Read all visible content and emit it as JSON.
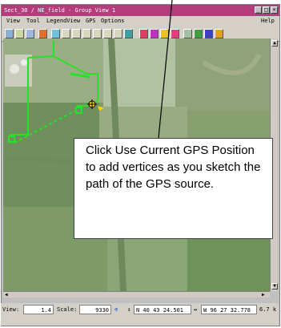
{
  "window": {
    "title": "Sect_30 / NE_field - Group View 1",
    "controls": [
      "_",
      "□",
      "×"
    ]
  },
  "menubar": {
    "items": [
      "View",
      "Tool",
      "LegendView",
      "GPS",
      "Options"
    ],
    "help": "Help"
  },
  "toolbar": {
    "icons": [
      "view-icon",
      "grid-icon",
      "layers-icon",
      "legend-icon",
      "select-icon",
      "zoom-in-icon",
      "zoom-out-icon",
      "pan-icon",
      "zoom-box-icon",
      "zoom-full-icon",
      "measure-icon",
      "gps-icon",
      "sketch-icon",
      "vertex-icon",
      "edit-icon",
      "flag-icon",
      "table-icon",
      "palette-icon",
      "hist-icon"
    ]
  },
  "statusbar": {
    "view_label": "View:",
    "view_value": "1.4",
    "scale_label": "Scale:",
    "scale_value": "9330",
    "lat_value": "N 40 43 24.501",
    "lon_value": "W 96 27 32.778",
    "extra_value": "6.7 k"
  },
  "callout": {
    "text": "Click Use Current GPS Position to add vertices as you sketch the path of the GPS source."
  },
  "colors": {
    "title_bar": "#b43c7c",
    "gps_path": "#28e028",
    "gps_cursor": "#ffd200"
  }
}
